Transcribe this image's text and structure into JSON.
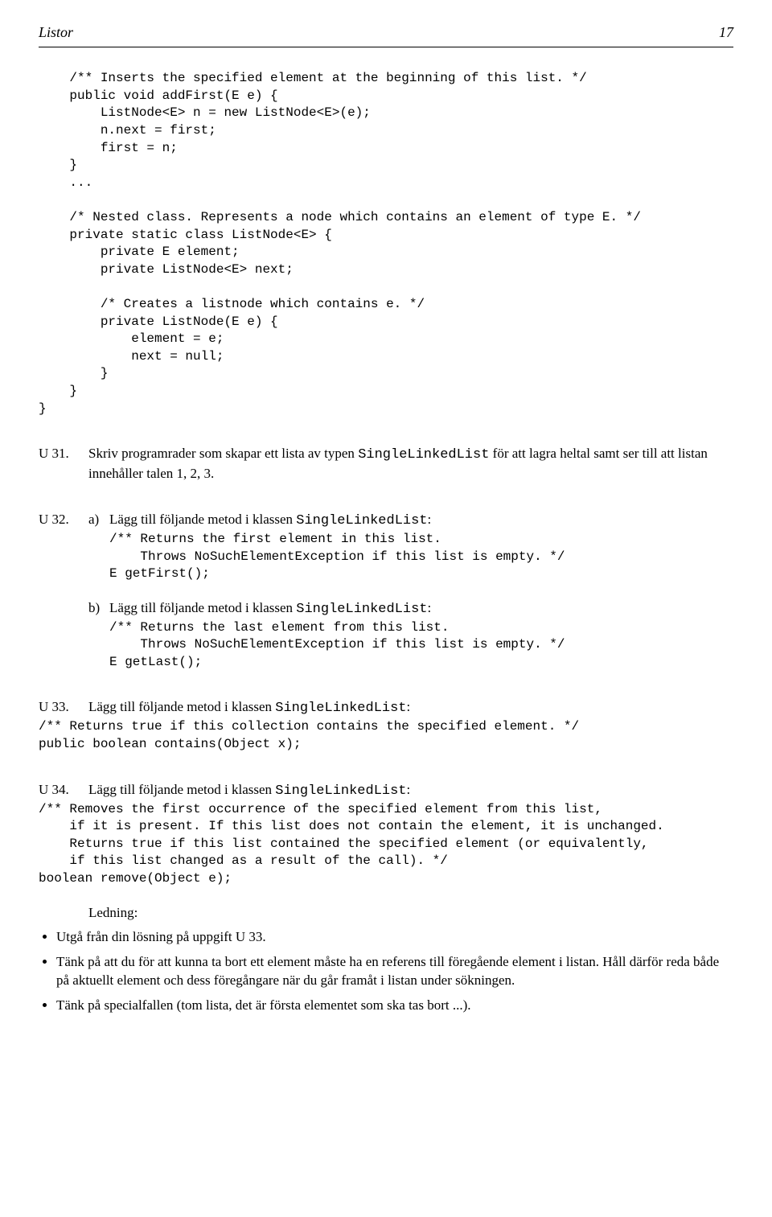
{
  "header": {
    "section": "Listor",
    "page": "17"
  },
  "code0": "    /** Inserts the specified element at the beginning of this list. */\n    public void addFirst(E e) {\n        ListNode<E> n = new ListNode<E>(e);\n        n.next = first;\n        first = n;\n    }\n    ...\n\n    /* Nested class. Represents a node which contains an element of type E. */\n    private static class ListNode<E> {\n        private E element;\n        private ListNode<E> next;\n\n        /* Creates a listnode which contains e. */\n        private ListNode(E e) {\n            element = e;\n            next = null;\n        }\n    }\n}",
  "u31": {
    "label": "U 31.",
    "text_a": "Skriv programrader som skapar ett lista av typen ",
    "code_a": "SingleLinkedList",
    "text_b": " för att lagra heltal samt ser till att listan innehåller talen 1, 2, 3."
  },
  "u32": {
    "label": "U 32.",
    "a_label": "a)",
    "a_text_a": "Lägg till följande metod i klassen ",
    "a_code": "SingleLinkedList",
    "a_text_b": ":",
    "a_block": "/** Returns the first element in this list.\n    Throws NoSuchElementException if this list is empty. */\nE getFirst();",
    "b_label": "b)",
    "b_text_a": "Lägg till följande metod i klassen ",
    "b_code": "SingleLinkedList",
    "b_text_b": ":",
    "b_block": "/** Returns the last element from this list.\n    Throws NoSuchElementException if this list is empty. */\nE getLast();"
  },
  "u33": {
    "label": "U 33.",
    "text_a": "Lägg till följande metod i klassen ",
    "code_a": "SingleLinkedList",
    "text_b": ":",
    "block": "/** Returns true if this collection contains the specified element. */\npublic boolean contains(Object x);"
  },
  "u34": {
    "label": "U 34.",
    "text_a": "Lägg till följande metod i klassen ",
    "code_a": "SingleLinkedList",
    "text_b": ":",
    "block": "/** Removes the first occurrence of the specified element from this list,\n    if it is present. If this list does not contain the element, it is unchanged.\n    Returns true if this list contained the specified element (or equivalently,\n    if this list changed as a result of the call). */\nboolean remove(Object e);",
    "ledning": "Ledning:",
    "bullet1": "Utgå från din lösning på uppgift U 33.",
    "bullet2": "Tänk på att du för att kunna ta bort ett element måste ha en referens till föregående element i listan. Håll därför reda både på aktuellt element och dess föregångare när du går framåt i listan under sökningen.",
    "bullet3": "Tänk på specialfallen (tom lista, det är första elementet som ska tas bort ...)."
  }
}
